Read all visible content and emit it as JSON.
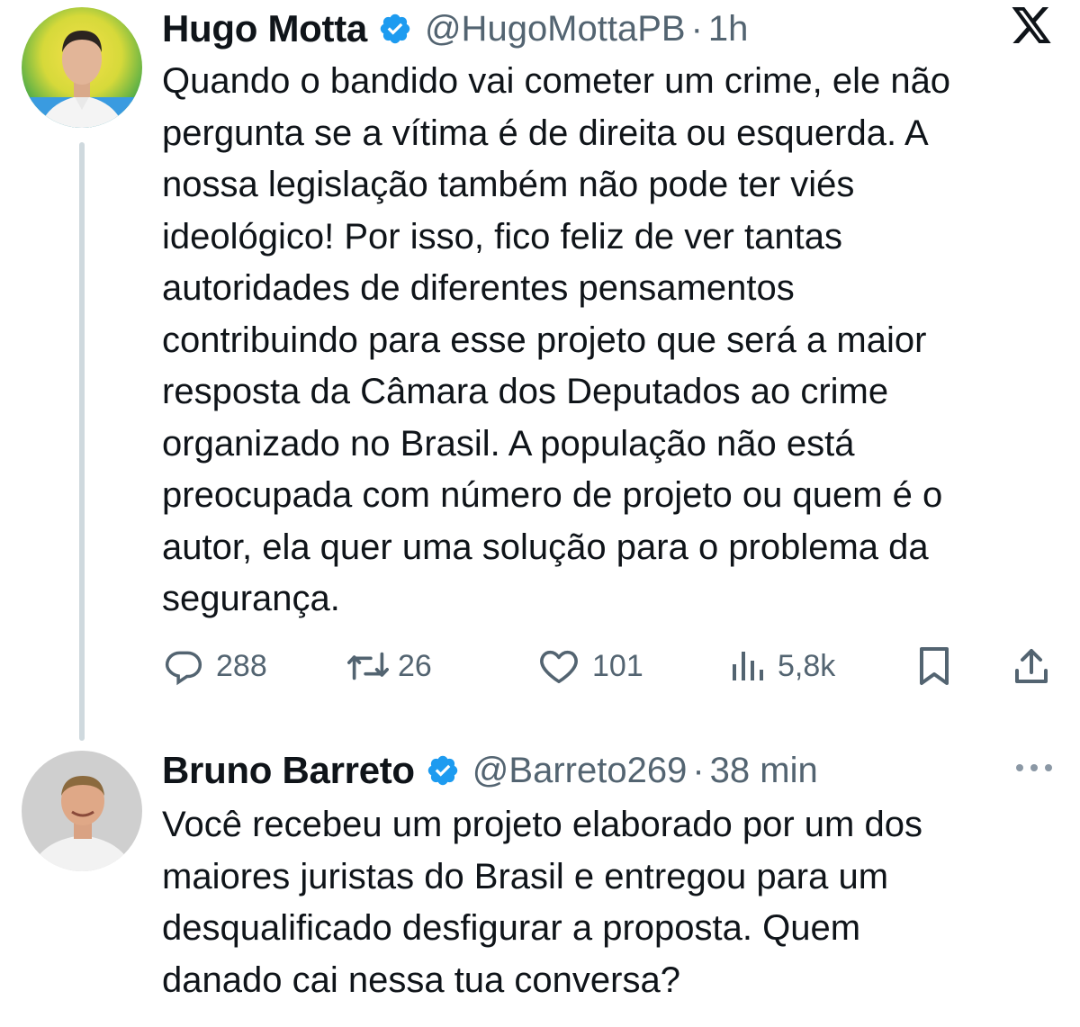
{
  "brand": {
    "logo_icon": "x-logo-icon"
  },
  "tweets": [
    {
      "author": "Hugo Motta",
      "handle": "@HugoMottaPB",
      "separator": "·",
      "time": "1h",
      "text": "Quando o bandido vai cometer um crime, ele não\npergunta se a vítima é de direita ou esquerda. A\nnossa legislação também não pode ter viés\nideológico! Por isso, fico feliz de ver tantas\nautoridades de diferentes pensamentos\ncontribuindo para esse projeto que será a maior\nresposta da Câmara dos Deputados ao crime\norganizado no Brasil. A população não está\npreocupada com número de projeto ou quem é o\nautor, ela quer uma solução para o problema da\nsegurança.",
      "verified": true,
      "actions": {
        "replies": "288",
        "retweets": "26",
        "likes": "101",
        "views": "5,8k"
      }
    },
    {
      "author": "Bruno Barreto",
      "handle": "@Barreto269",
      "separator": "·",
      "time": "38 min",
      "text": "Você recebeu um projeto elaborado por um dos\nmaiores juristas do Brasil e entregou para um\ndesqualificado desfigurar a proposta. Quem\ndanado cai nessa tua conversa?",
      "verified": true
    }
  ],
  "colors": {
    "verified": "#1d9bf0",
    "muted": "#536471",
    "text": "#0f1419",
    "thread_line": "#cfd9de"
  }
}
